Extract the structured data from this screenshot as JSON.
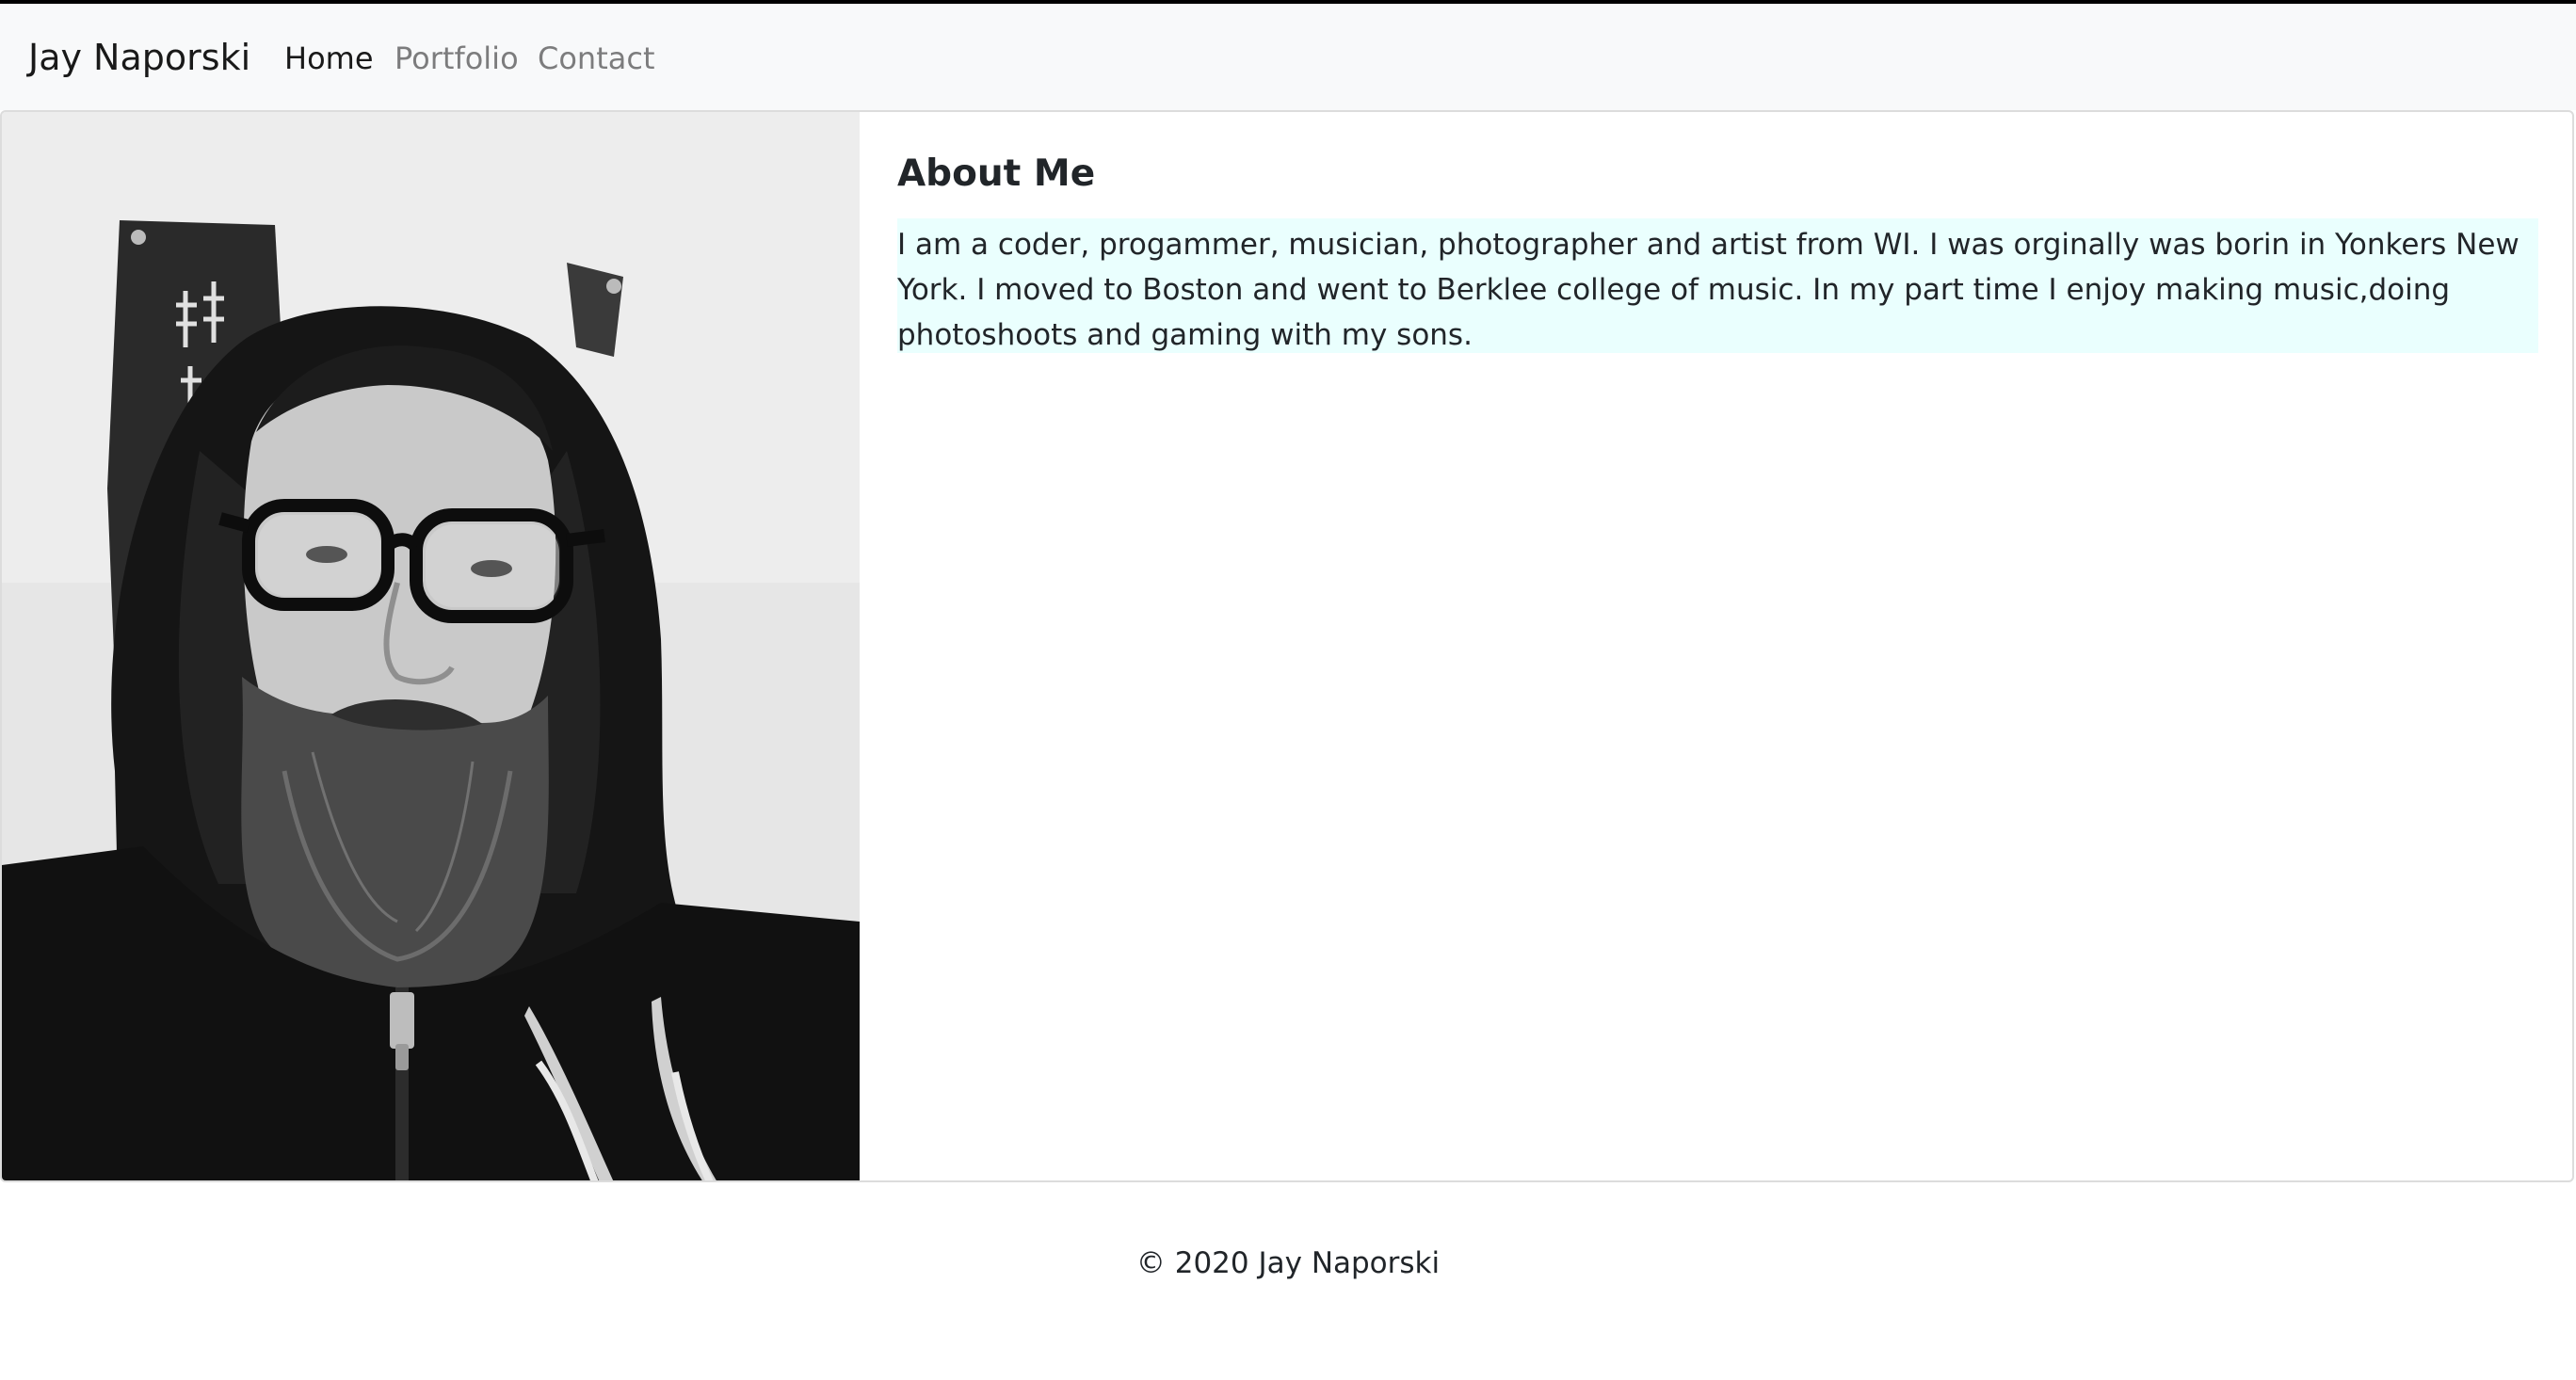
{
  "navbar": {
    "brand": "Jay Naporski",
    "links": [
      {
        "label": "Home",
        "active": true
      },
      {
        "label": "Portfolio",
        "active": false
      },
      {
        "label": "Contact",
        "active": false
      }
    ]
  },
  "about": {
    "title": "About Me",
    "text": "I am a coder, progammer, musician, photographer and artist from WI. I was orginally was borin in Yonkers New York. I moved to Boston and went to Berklee college of music. In my part time I enjoy making music,doing photoshoots and gaming with my sons."
  },
  "footer": {
    "copyright": "© 2020 Jay Naporski"
  },
  "colors": {
    "navbar_bg": "#f8f9fa",
    "highlight_bg": "#eafffe",
    "text": "#212529"
  }
}
